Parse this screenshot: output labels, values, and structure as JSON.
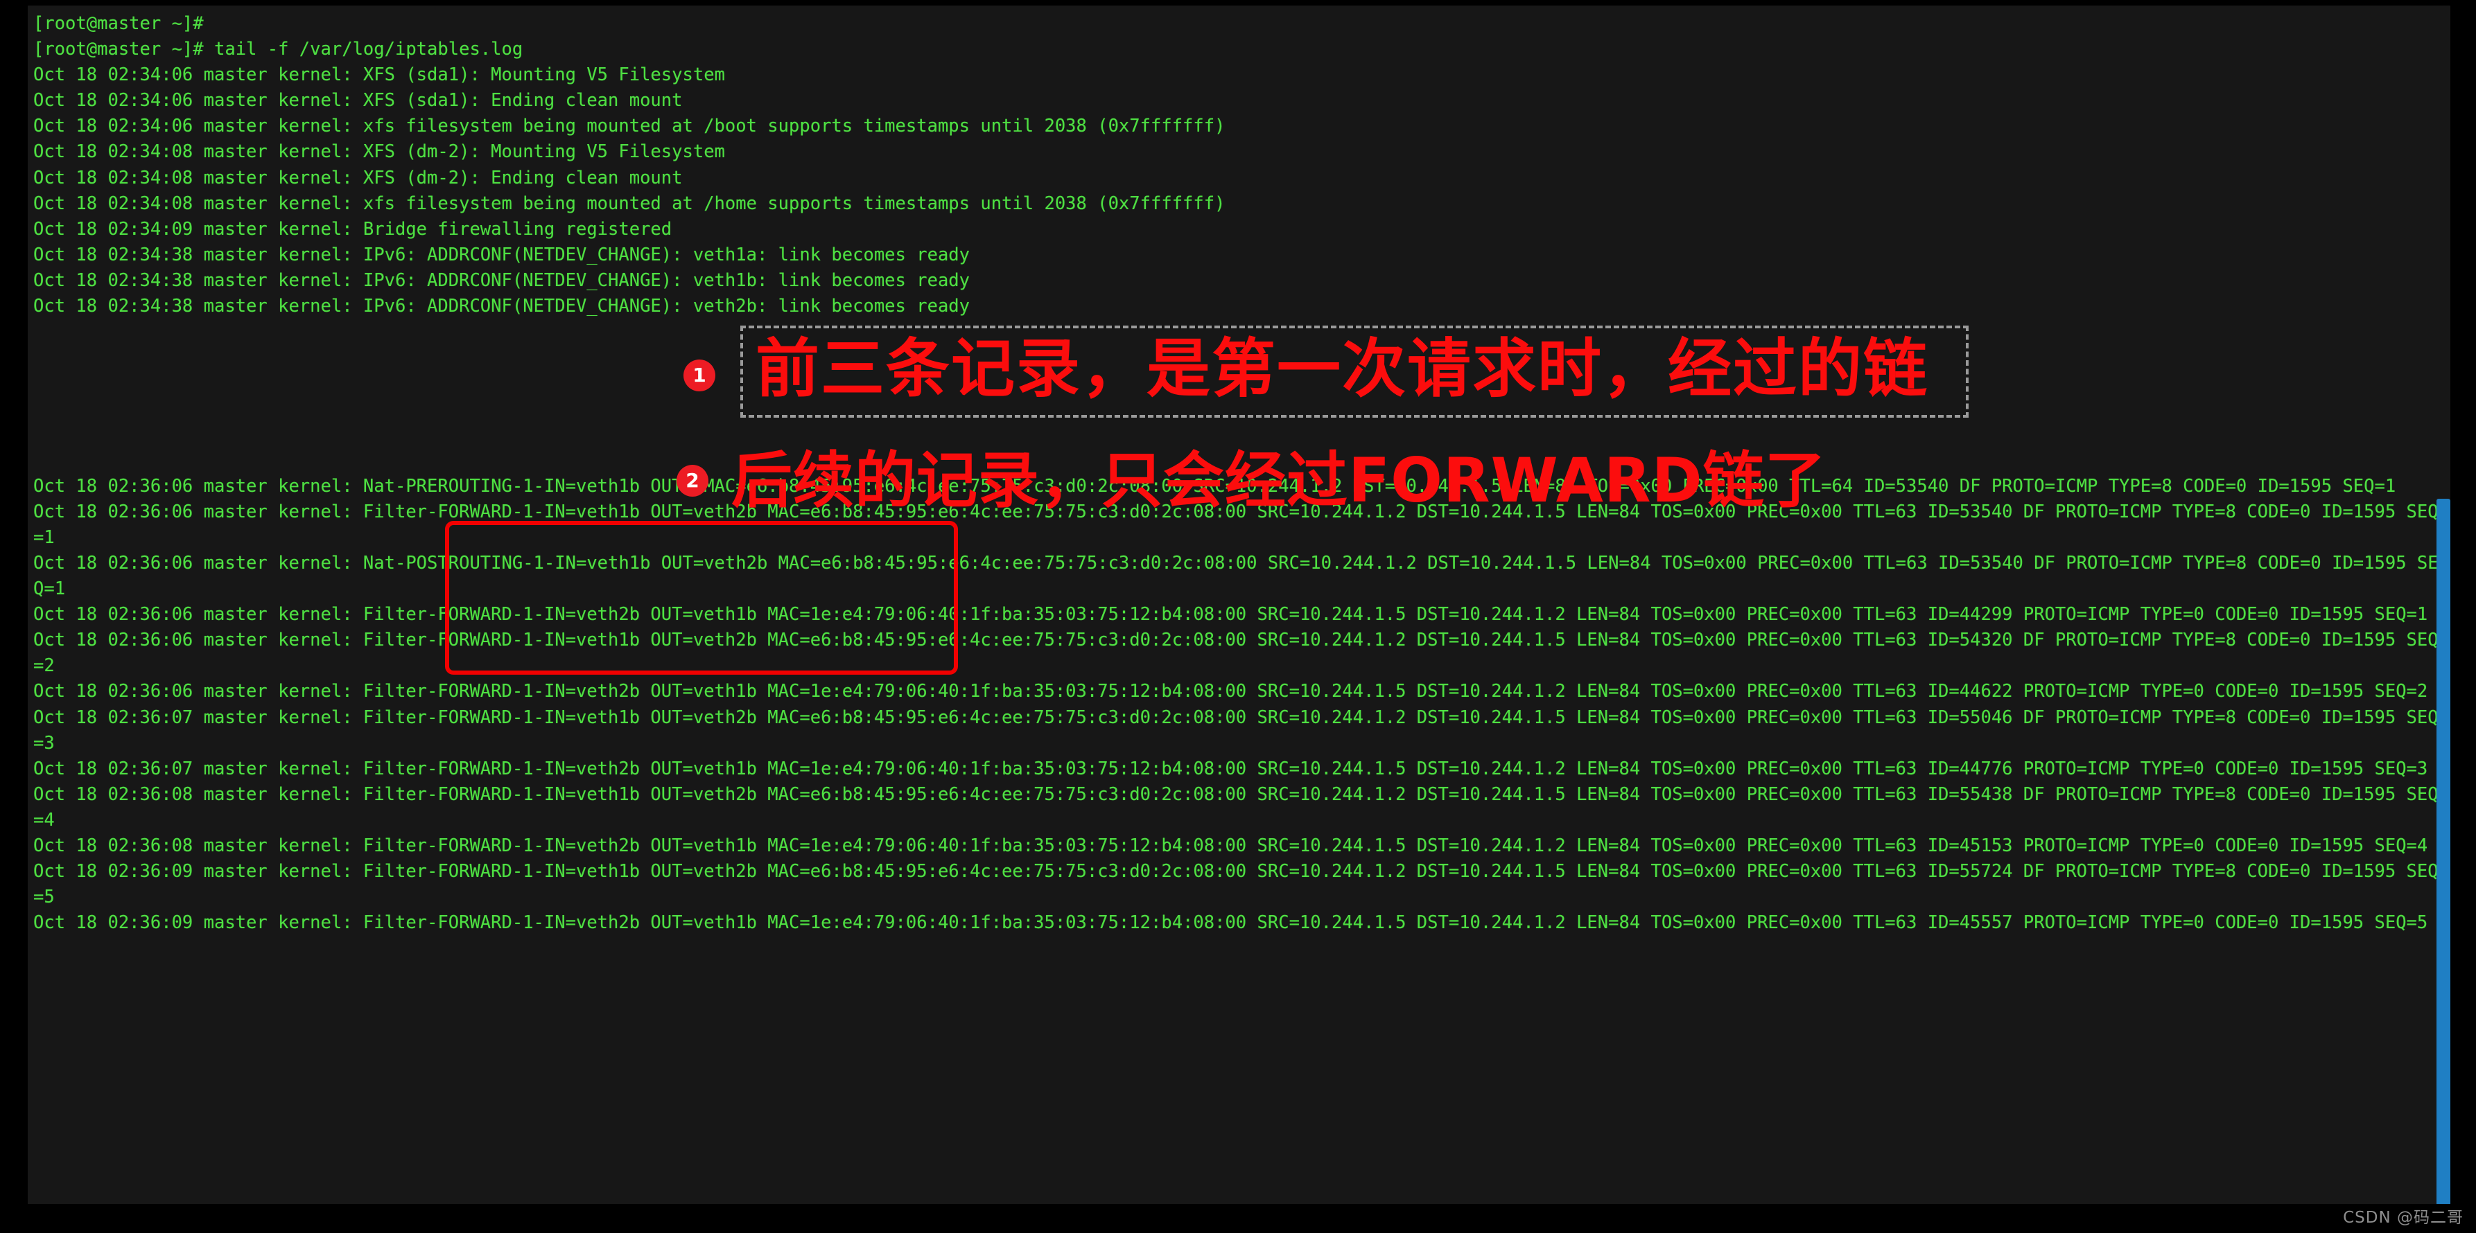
{
  "terminal": {
    "prompt_lines": [
      "[root@master ~]#",
      "[root@master ~]# tail -f /var/log/iptables.log"
    ],
    "log_lines": [
      "Oct 18 02:34:06 master kernel: XFS (sda1): Mounting V5 Filesystem",
      "Oct 18 02:34:06 master kernel: XFS (sda1): Ending clean mount",
      "Oct 18 02:34:06 master kernel: xfs filesystem being mounted at /boot supports timestamps until 2038 (0x7fffffff)",
      "Oct 18 02:34:08 master kernel: XFS (dm-2): Mounting V5 Filesystem",
      "Oct 18 02:34:08 master kernel: XFS (dm-2): Ending clean mount",
      "Oct 18 02:34:08 master kernel: xfs filesystem being mounted at /home supports timestamps until 2038 (0x7fffffff)",
      "Oct 18 02:34:09 master kernel: Bridge firewalling registered",
      "Oct 18 02:34:38 master kernel: IPv6: ADDRCONF(NETDEV_CHANGE): veth1a: link becomes ready",
      "Oct 18 02:34:38 master kernel: IPv6: ADDRCONF(NETDEV_CHANGE): veth1b: link becomes ready",
      "Oct 18 02:34:38 master kernel: IPv6: ADDRCONF(NETDEV_CHANGE): veth2b: link becomes ready"
    ],
    "blank_gap_lines": 6,
    "packet_lines": [
      "Oct 18 02:36:06 master kernel: Nat-PREROUTING-1-IN=veth1b OUT= MAC=e6:b8:45:95:e6:4c:ee:75:75:c3:d0:2c:08:00 SRC=10.244.1.2 DST=10.244.1.5 LEN=84 TOS=0x00 PREC=0x00 TTL=64 ID=53540 DF PROTO=ICMP TYPE=8 CODE=0 ID=1595 SEQ=1",
      "Oct 18 02:36:06 master kernel: Filter-FORWARD-1-IN=veth1b OUT=veth2b MAC=e6:b8:45:95:e6:4c:ee:75:75:c3:d0:2c:08:00 SRC=10.244.1.2 DST=10.244.1.5 LEN=84 TOS=0x00 PREC=0x00 TTL=63 ID=53540 DF PROTO=ICMP TYPE=8 CODE=0 ID=1595 SEQ=1",
      "Oct 18 02:36:06 master kernel: Nat-POSTROUTING-1-IN=veth1b OUT=veth2b MAC=e6:b8:45:95:e6:4c:ee:75:75:c3:d0:2c:08:00 SRC=10.244.1.2 DST=10.244.1.5 LEN=84 TOS=0x00 PREC=0x00 TTL=63 ID=53540 DF PROTO=ICMP TYPE=8 CODE=0 ID=1595 SEQ=1",
      "Oct 18 02:36:06 master kernel: Filter-FORWARD-1-IN=veth2b OUT=veth1b MAC=1e:e4:79:06:40:1f:ba:35:03:75:12:b4:08:00 SRC=10.244.1.5 DST=10.244.1.2 LEN=84 TOS=0x00 PREC=0x00 TTL=63 ID=44299 PROTO=ICMP TYPE=0 CODE=0 ID=1595 SEQ=1",
      "Oct 18 02:36:06 master kernel: Filter-FORWARD-1-IN=veth1b OUT=veth2b MAC=e6:b8:45:95:e6:4c:ee:75:75:c3:d0:2c:08:00 SRC=10.244.1.2 DST=10.244.1.5 LEN=84 TOS=0x00 PREC=0x00 TTL=63 ID=54320 DF PROTO=ICMP TYPE=8 CODE=0 ID=1595 SEQ=2",
      "Oct 18 02:36:06 master kernel: Filter-FORWARD-1-IN=veth2b OUT=veth1b MAC=1e:e4:79:06:40:1f:ba:35:03:75:12:b4:08:00 SRC=10.244.1.5 DST=10.244.1.2 LEN=84 TOS=0x00 PREC=0x00 TTL=63 ID=44622 PROTO=ICMP TYPE=0 CODE=0 ID=1595 SEQ=2",
      "Oct 18 02:36:07 master kernel: Filter-FORWARD-1-IN=veth1b OUT=veth2b MAC=e6:b8:45:95:e6:4c:ee:75:75:c3:d0:2c:08:00 SRC=10.244.1.2 DST=10.244.1.5 LEN=84 TOS=0x00 PREC=0x00 TTL=63 ID=55046 DF PROTO=ICMP TYPE=8 CODE=0 ID=1595 SEQ=3",
      "Oct 18 02:36:07 master kernel: Filter-FORWARD-1-IN=veth2b OUT=veth1b MAC=1e:e4:79:06:40:1f:ba:35:03:75:12:b4:08:00 SRC=10.244.1.5 DST=10.244.1.2 LEN=84 TOS=0x00 PREC=0x00 TTL=63 ID=44776 PROTO=ICMP TYPE=0 CODE=0 ID=1595 SEQ=3",
      "Oct 18 02:36:08 master kernel: Filter-FORWARD-1-IN=veth1b OUT=veth2b MAC=e6:b8:45:95:e6:4c:ee:75:75:c3:d0:2c:08:00 SRC=10.244.1.2 DST=10.244.1.5 LEN=84 TOS=0x00 PREC=0x00 TTL=63 ID=55438 DF PROTO=ICMP TYPE=8 CODE=0 ID=1595 SEQ=4",
      "Oct 18 02:36:08 master kernel: Filter-FORWARD-1-IN=veth2b OUT=veth1b MAC=1e:e4:79:06:40:1f:ba:35:03:75:12:b4:08:00 SRC=10.244.1.5 DST=10.244.1.2 LEN=84 TOS=0x00 PREC=0x00 TTL=63 ID=45153 PROTO=ICMP TYPE=0 CODE=0 ID=1595 SEQ=4",
      "Oct 18 02:36:09 master kernel: Filter-FORWARD-1-IN=veth1b OUT=veth2b MAC=e6:b8:45:95:e6:4c:ee:75:75:c3:d0:2c:08:00 SRC=10.244.1.2 DST=10.244.1.5 LEN=84 TOS=0x00 PREC=0x00 TTL=63 ID=55724 DF PROTO=ICMP TYPE=8 CODE=0 ID=1595 SEQ=5",
      "Oct 18 02:36:09 master kernel: Filter-FORWARD-1-IN=veth2b OUT=veth1b MAC=1e:e4:79:06:40:1f:ba:35:03:75:12:b4:08:00 SRC=10.244.1.5 DST=10.244.1.2 LEN=84 TOS=0x00 PREC=0x00 TTL=63 ID=45557 PROTO=ICMP TYPE=0 CODE=0 ID=1595 SEQ=5"
    ]
  },
  "annotations": {
    "badge_1": "1",
    "badge_2": "2",
    "text_1": "前三条记录，是第一次请求时，经过的链",
    "text_2": "后续的记录，只会经过FORWARD链了"
  },
  "colors": {
    "terminal_background": "#171717",
    "terminal_text": "#4ee042",
    "annotation_red": "#fc0d0d",
    "badge_red": "#ed1c24",
    "dashed_gray": "#9a9a9a",
    "scrollbar_blue": "#1f7fc4"
  },
  "watermark": {
    "text": "CSDN @码二哥"
  }
}
